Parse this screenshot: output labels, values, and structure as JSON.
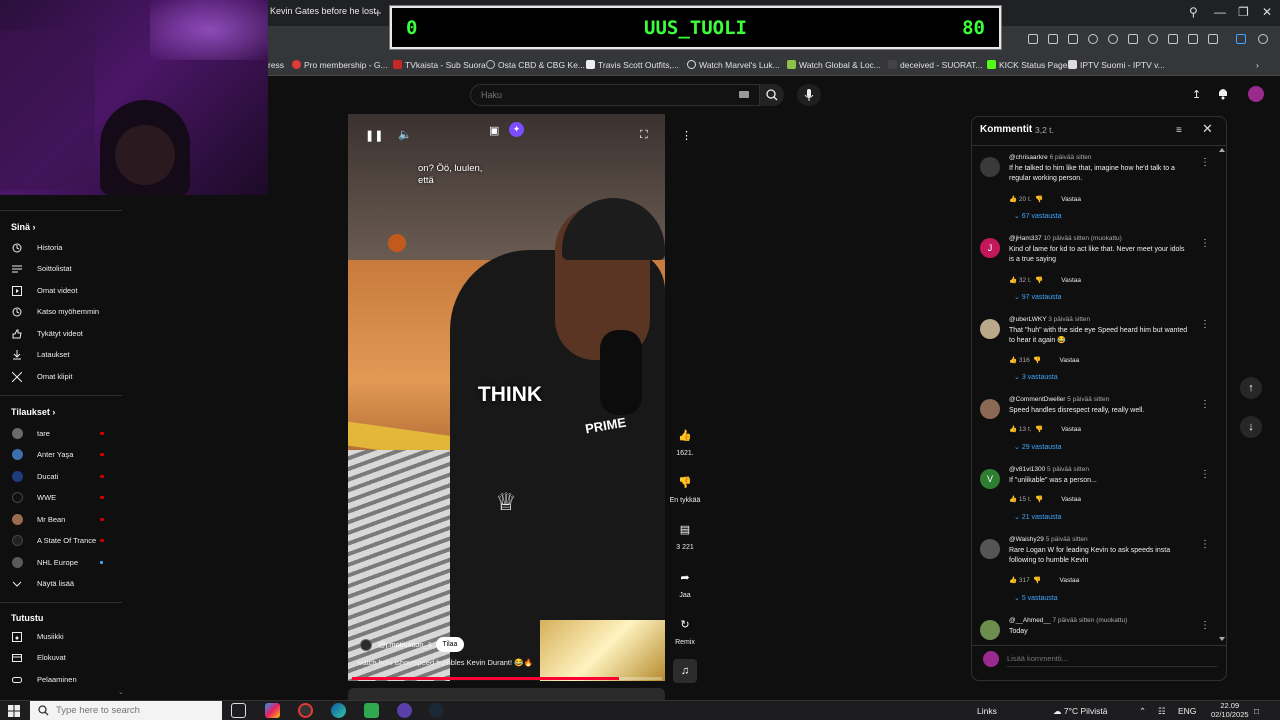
{
  "browser": {
    "tab_title": "Kevin Gates before he lost",
    "bookmarks": [
      "ress",
      "Pro membership - G...",
      "TVkaista - Sub Suora",
      "Osta CBD & CBG Ke...",
      "Travis Scott Outfits,...",
      "Watch Marvel's Luk...",
      "Watch Global & Loc...",
      "deceived - SUORAT...",
      "KICK Status Page",
      "IPTV Suomi - IPTV v..."
    ]
  },
  "overlay_banner": {
    "left": "0",
    "center": "UUS_TUOLI",
    "right": "80"
  },
  "header": {
    "search_placeholder": "Haku"
  },
  "sidebar": {
    "you_heading": "Sinä",
    "you_items": [
      "Historia",
      "Soittolistat",
      "Omat videot",
      "Katso myöhemmin",
      "Tykätyt videot",
      "Lataukset",
      "Omat klipit"
    ],
    "subs_heading": "Tilaukset",
    "subs_items": [
      {
        "label": "tare",
        "color": "#6a6a6a"
      },
      {
        "label": "Anter Yaşa",
        "color": "#3b6fb0"
      },
      {
        "label": "Ducati",
        "color": "#1e3d7a"
      },
      {
        "label": "WWE",
        "color": "#111111"
      },
      {
        "label": "Mr Bean",
        "color": "#9a6b4c"
      },
      {
        "label": "A State Of Trance",
        "color": "#222222"
      },
      {
        "label": "NHL Europe",
        "color": "#5a5a5a"
      }
    ],
    "show_more": "Näytä lisää",
    "explore_heading": "Tutustu",
    "explore_items": [
      "Musiikki",
      "Elokuvat",
      "Pelaaminen"
    ]
  },
  "video": {
    "caption": "on? Öö, luulen, että",
    "overlay_word": "THINK",
    "shirt_text": "PRIME",
    "channel": "@j.motivation_1",
    "subscribe": "Tilaa",
    "title": "watch how ishowspeed humbles Kevin Durant! 😂🔥",
    "progress": 0.86
  },
  "actions": {
    "likes": "1621.",
    "dislike": "En tykkää",
    "comments": "3 221",
    "share": "Jaa",
    "remix": "Remix"
  },
  "comments": {
    "title": "Kommentit",
    "count": "3,2 t.",
    "input_placeholder": "Lisää kommentti...",
    "reply_label": "Vastaa",
    "items": [
      {
        "author": "@chrisaarkre",
        "time": "6 päivää sitten",
        "text": "If he talked to him like that, imagine how he'd talk to a regular working person.",
        "likes": "20 t.",
        "replies": "67 vastausta",
        "avatar": "#3a3a3a",
        "letter": ""
      },
      {
        "author": "@jHam337",
        "time": "10 päivää sitten (muokattu)",
        "text": "Kind of lame for kd to act like that. Never meet your idols is a true saying",
        "likes": "32 t.",
        "replies": "97 vastausta",
        "avatar": "#c2185b",
        "letter": "J"
      },
      {
        "author": "@uberLWKY",
        "time": "3 päivää sitten",
        "text": "That \"huh\" with the side eye Speed heard him but wanted to hear it again 😂",
        "likes": "316",
        "replies": "3 vastausta",
        "avatar": "#b9a98a",
        "letter": ""
      },
      {
        "author": "@CommentDweller",
        "time": "5 päivää sitten",
        "text": "Speed handles disrespect really, really well.",
        "likes": "13 t.",
        "replies": "29 vastausta",
        "avatar": "#8a6a55",
        "letter": ""
      },
      {
        "author": "@v81vi1300",
        "time": "5 päivää sitten",
        "text": "If \"unlikable\" was a person...",
        "likes": "15 t.",
        "replies": "21 vastausta",
        "avatar": "#2e7d32",
        "letter": "V"
      },
      {
        "author": "@Waishy29",
        "time": "5 päivää sitten",
        "text": "Rare Logan W for leading Kevin to ask speeds insta following to humble Kevin",
        "likes": "317",
        "replies": "5 vastausta",
        "avatar": "#555555",
        "letter": ""
      },
      {
        "author": "@__Ahmed__",
        "time": "7 päivää sitten (muokattu)",
        "text": "Today",
        "likes": "",
        "replies": "",
        "avatar": "#6b8e4e",
        "letter": ""
      }
    ]
  },
  "taskbar": {
    "search_placeholder": "Type here to search",
    "links": "Links",
    "weather": "7°C  Pilvistä",
    "language": "ENG",
    "time": "22.09",
    "date": "02/10/2025"
  }
}
